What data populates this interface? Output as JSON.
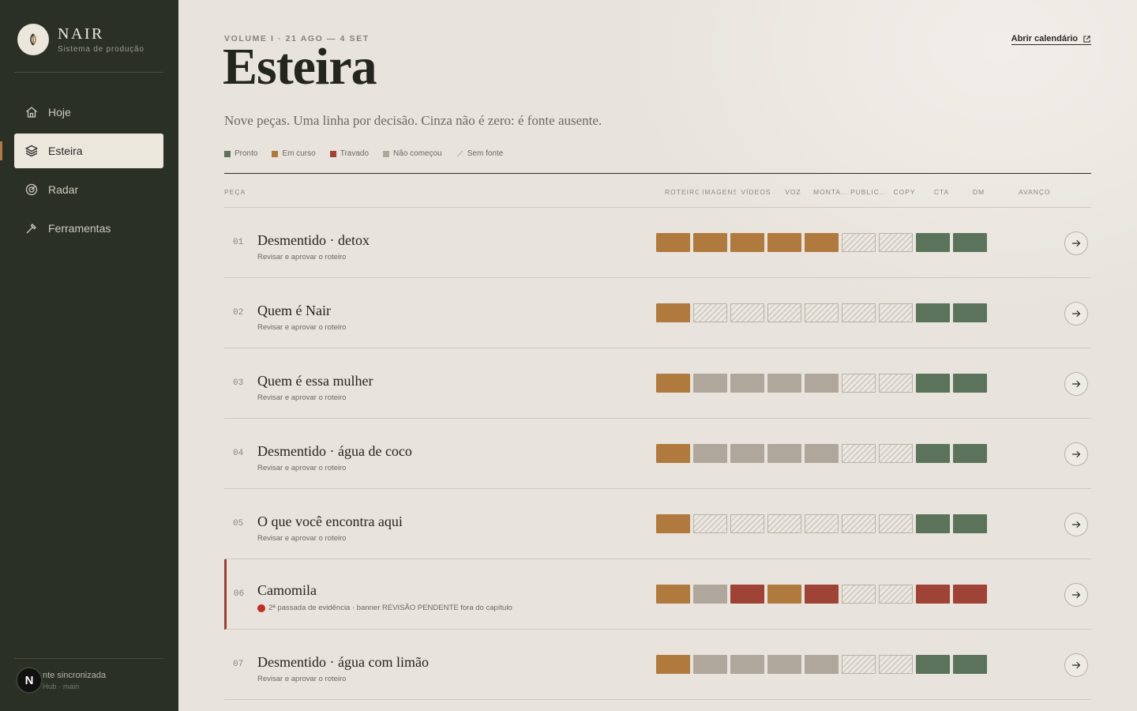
{
  "sidebar": {
    "brand_name": "NAIR",
    "brand_sub": "Sistema de produção",
    "nav": [
      {
        "label": "Hoje",
        "icon": "home-icon",
        "active": false
      },
      {
        "label": "Esteira",
        "icon": "layers-icon",
        "active": true
      },
      {
        "label": "Radar",
        "icon": "radar-icon",
        "active": false
      },
      {
        "label": "Ferramentas",
        "icon": "tool-icon",
        "active": false
      }
    ],
    "sync_badge": "N",
    "sync_status": "nte sincronizada",
    "sync_branch": "Hub · main"
  },
  "header": {
    "eyebrow": "VOLUME I · 21 AGO — 4 SET",
    "title": "Esteira",
    "subtitle": "Nove peças. Uma linha por decisão. Cinza não é zero: é fonte ausente.",
    "open_calendar": "Abrir calendário"
  },
  "legend": [
    {
      "label": "Pronto",
      "color": "#5a735a"
    },
    {
      "label": "Em curso",
      "color": "#b07a3e"
    },
    {
      "label": "Travado",
      "color": "#9e4336"
    },
    {
      "label": "Não começou",
      "color": "#afa79b"
    },
    {
      "label": "Sem fonte",
      "color": "#c2bbb0"
    }
  ],
  "columns": {
    "piece": "PEÇA",
    "stages": [
      "ROTEIRO",
      "IMAGENS",
      "VÍDEOS",
      "VOZ",
      "MONTA...",
      "PUBLIC...",
      "COPY",
      "CTA",
      "DM"
    ],
    "progress": "AVANÇO"
  },
  "rows": [
    {
      "num": "01",
      "title": "Desmentido · detox",
      "note": "Revisar e aprovar o roteiro",
      "alert": false,
      "cells": [
        "curso",
        "curso",
        "curso",
        "curso",
        "curso",
        "sem",
        "sem",
        "pronto",
        "pronto"
      ]
    },
    {
      "num": "02",
      "title": "Quem é Nair",
      "note": "Revisar e aprovar o roteiro",
      "alert": false,
      "cells": [
        "curso",
        "sem",
        "sem",
        "sem",
        "sem",
        "sem",
        "sem",
        "pronto",
        "pronto"
      ]
    },
    {
      "num": "03",
      "title": "Quem é essa mulher",
      "note": "Revisar e aprovar o roteiro",
      "alert": false,
      "cells": [
        "curso",
        "nao",
        "nao",
        "nao",
        "nao",
        "sem",
        "sem",
        "pronto",
        "pronto"
      ]
    },
    {
      "num": "04",
      "title": "Desmentido · água de coco",
      "note": "Revisar e aprovar o roteiro",
      "alert": false,
      "cells": [
        "curso",
        "nao",
        "nao",
        "nao",
        "nao",
        "sem",
        "sem",
        "pronto",
        "pronto"
      ]
    },
    {
      "num": "05",
      "title": "O que você encontra aqui",
      "note": "Revisar e aprovar o roteiro",
      "alert": false,
      "cells": [
        "curso",
        "sem",
        "sem",
        "sem",
        "sem",
        "sem",
        "sem",
        "pronto",
        "pronto"
      ]
    },
    {
      "num": "06",
      "title": "Camomila",
      "note": "2ª passada de evidência · banner REVISÃO PENDENTE fora do capítulo",
      "alert": true,
      "cells": [
        "curso",
        "nao",
        "travado",
        "curso",
        "travado",
        "sem",
        "sem",
        "travado",
        "travado"
      ]
    },
    {
      "num": "07",
      "title": "Desmentido · água com limão",
      "note": "Revisar e aprovar o roteiro",
      "alert": false,
      "cells": [
        "curso",
        "nao",
        "nao",
        "nao",
        "nao",
        "sem",
        "sem",
        "pronto",
        "pronto"
      ]
    }
  ]
}
